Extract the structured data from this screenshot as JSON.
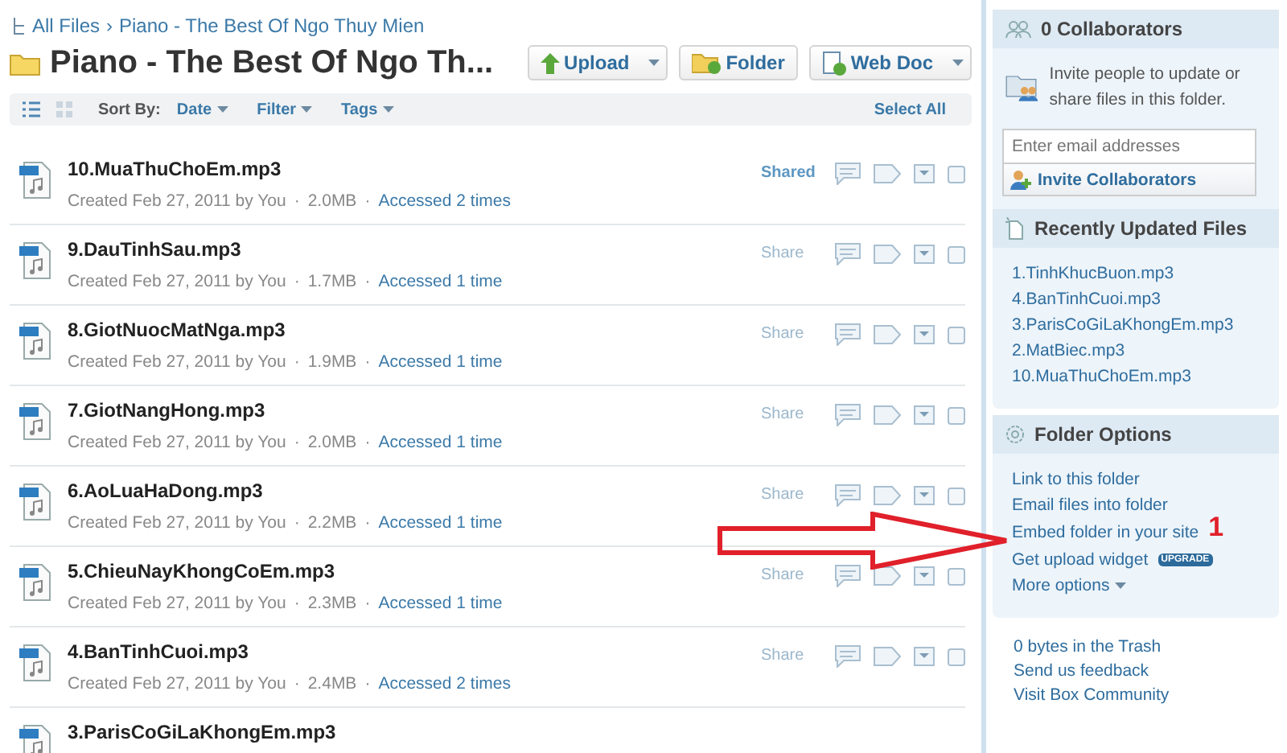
{
  "breadcrumb": {
    "items": [
      "All Files",
      "Piano - The Best Of Ngo Thuy Mien"
    ],
    "separator": "›"
  },
  "folder_title": "Piano - The Best Of Ngo Th...",
  "actions": [
    {
      "label": "Upload",
      "kind": "upload",
      "dropdown": true
    },
    {
      "label": "Folder",
      "kind": "folder",
      "dropdown": false
    },
    {
      "label": "Web Doc",
      "kind": "webdoc",
      "dropdown": true
    }
  ],
  "toolbar": {
    "views": [
      {
        "kind": "list",
        "selected": true
      },
      {
        "kind": "grid",
        "selected": false
      }
    ],
    "sort_label": "Sort By:",
    "menus": [
      "Date",
      "Filter",
      "Tags"
    ],
    "select_all": "Select All"
  },
  "files": [
    {
      "name": "10.MuaThuChoEm.mp3",
      "meta": "Created Feb 27, 2011 by You",
      "size": "2.0MB",
      "separators": [
        "·",
        "·"
      ],
      "accessed": "Accessed 2 times",
      "share": "Shared",
      "shared": true,
      "checked": false
    },
    {
      "name": "9.DauTinhSau.mp3",
      "meta": "Created Feb 27, 2011 by You",
      "size": "1.7MB",
      "separators": [
        "·",
        "·"
      ],
      "accessed": "Accessed 1 time",
      "share": "Share",
      "shared": false,
      "checked": false
    },
    {
      "name": "8.GiotNuocMatNga.mp3",
      "meta": "Created Feb 27, 2011 by You",
      "size": "1.9MB",
      "separators": [
        "·",
        "·"
      ],
      "accessed": "Accessed 1 time",
      "share": "Share",
      "shared": false,
      "checked": false
    },
    {
      "name": "7.GiotNangHong.mp3",
      "meta": "Created Feb 27, 2011 by You",
      "size": "2.0MB",
      "separators": [
        "·",
        "·"
      ],
      "accessed": "Accessed 1 time",
      "share": "Share",
      "shared": false,
      "checked": false
    },
    {
      "name": "6.AoLuaHaDong.mp3",
      "meta": "Created Feb 27, 2011 by You",
      "size": "2.2MB",
      "separators": [
        "·",
        "·"
      ],
      "accessed": "Accessed 1 time",
      "share": "Share",
      "shared": false,
      "checked": false
    },
    {
      "name": "5.ChieuNayKhongCoEm.mp3",
      "meta": "Created Feb 27, 2011 by You",
      "size": "2.3MB",
      "separators": [
        "·",
        "·"
      ],
      "accessed": "Accessed 1 time",
      "share": "Share",
      "shared": false,
      "checked": false
    },
    {
      "name": "4.BanTinhCuoi.mp3",
      "meta": "Created Feb 27, 2011 by You",
      "size": "2.4MB",
      "separators": [
        "·",
        "·"
      ],
      "accessed": "Accessed 2 times",
      "share": "Share",
      "shared": false,
      "checked": false
    },
    {
      "name": "3.ParisCoGiLaKhongEm.mp3"
    }
  ],
  "sidebar": {
    "collaborators": {
      "title": "0 Collaborators",
      "text": "Invite people to update or share files in this folder.",
      "email": {
        "placeholder": "Enter email addresses"
      },
      "invite_button": "Invite Collaborators"
    },
    "recent": {
      "title": "Recently Updated Files",
      "items": [
        "1.TinhKhucBuon.mp3",
        "4.BanTinhCuoi.mp3",
        "3.ParisCoGiLaKhongEm.mp3",
        "2.MatBiec.mp3",
        "10.MuaThuChoEm.mp3"
      ]
    },
    "folder_options": {
      "title": "Folder Options",
      "links": [
        {
          "label": "Link to this folder"
        },
        {
          "label": "Email files into folder"
        },
        {
          "label": "Embed folder in your site",
          "annotation": "1"
        },
        {
          "label": "Get upload widget",
          "badge": "UPGRADE"
        },
        {
          "label": "More options",
          "dropdown": true
        }
      ]
    },
    "footer_links": [
      "0 bytes in the Trash",
      "Send us feedback",
      "Visit Box Community"
    ]
  }
}
